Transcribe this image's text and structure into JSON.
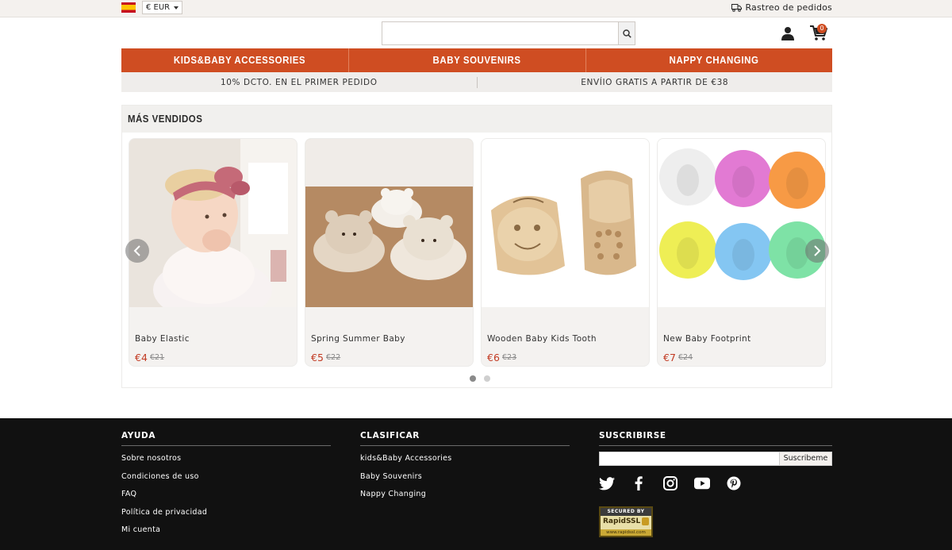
{
  "topbar": {
    "currency": "€ EUR",
    "track_label": "Rastreo de pedidos"
  },
  "header": {
    "search": {
      "value": "",
      "placeholder": ""
    },
    "cart_count": "0"
  },
  "categories": [
    {
      "label": "KIDS&BABY ACCESSORIES"
    },
    {
      "label": "BABY SOUVENIRS"
    },
    {
      "label": "NAPPY CHANGING"
    }
  ],
  "promo": [
    {
      "text": "10% DCTO. EN EL PRIMER PEDIDO"
    },
    {
      "text": "ENVÍIO GRATIS A PARTIR DE €38"
    }
  ],
  "bestsellers": {
    "title": "MÁS VENDIDOS",
    "products": [
      {
        "name": "Baby Elastic",
        "price": "€4",
        "old_price": "€21",
        "image": "baby-with-bow-headband"
      },
      {
        "name": "Spring Summer Baby",
        "price": "€5",
        "old_price": "€22",
        "image": "bear-bucket-hats"
      },
      {
        "name": "Wooden Baby Kids Tooth",
        "price": "€6",
        "old_price": "€23",
        "image": "wooden-tooth-box"
      },
      {
        "name": "New Baby Footprint",
        "price": "€7",
        "old_price": "€24",
        "image": "colored-clay-footprints"
      }
    ],
    "pagination": {
      "pages": 2,
      "current": 1
    }
  },
  "footer": {
    "help": {
      "title": "AYUDA",
      "links": [
        "Sobre nosotros",
        "Condiciones de uso",
        "FAQ",
        "Política de privacidad",
        "Mi cuenta"
      ]
    },
    "classify": {
      "title": "CLASIFICAR",
      "links": [
        "kids&Baby Accessories",
        "Baby Souvenirs",
        "Nappy Changing"
      ]
    },
    "subscribe": {
      "title": "SUSCRIBIRSE",
      "input_value": "",
      "button": "Suscribeme",
      "social": [
        "twitter-icon",
        "facebook-icon",
        "instagram-icon",
        "youtube-icon",
        "pinterest-icon"
      ]
    },
    "ssl_badge": {
      "top": "SECURED BY",
      "middle": "RapidSSL",
      "bottom": "www.rapidssl.com"
    }
  },
  "colors": {
    "accent": "#cf4d22",
    "price": "#c23a22",
    "footer_bg": "#111111",
    "topbar_bg": "#f4f1ee"
  }
}
